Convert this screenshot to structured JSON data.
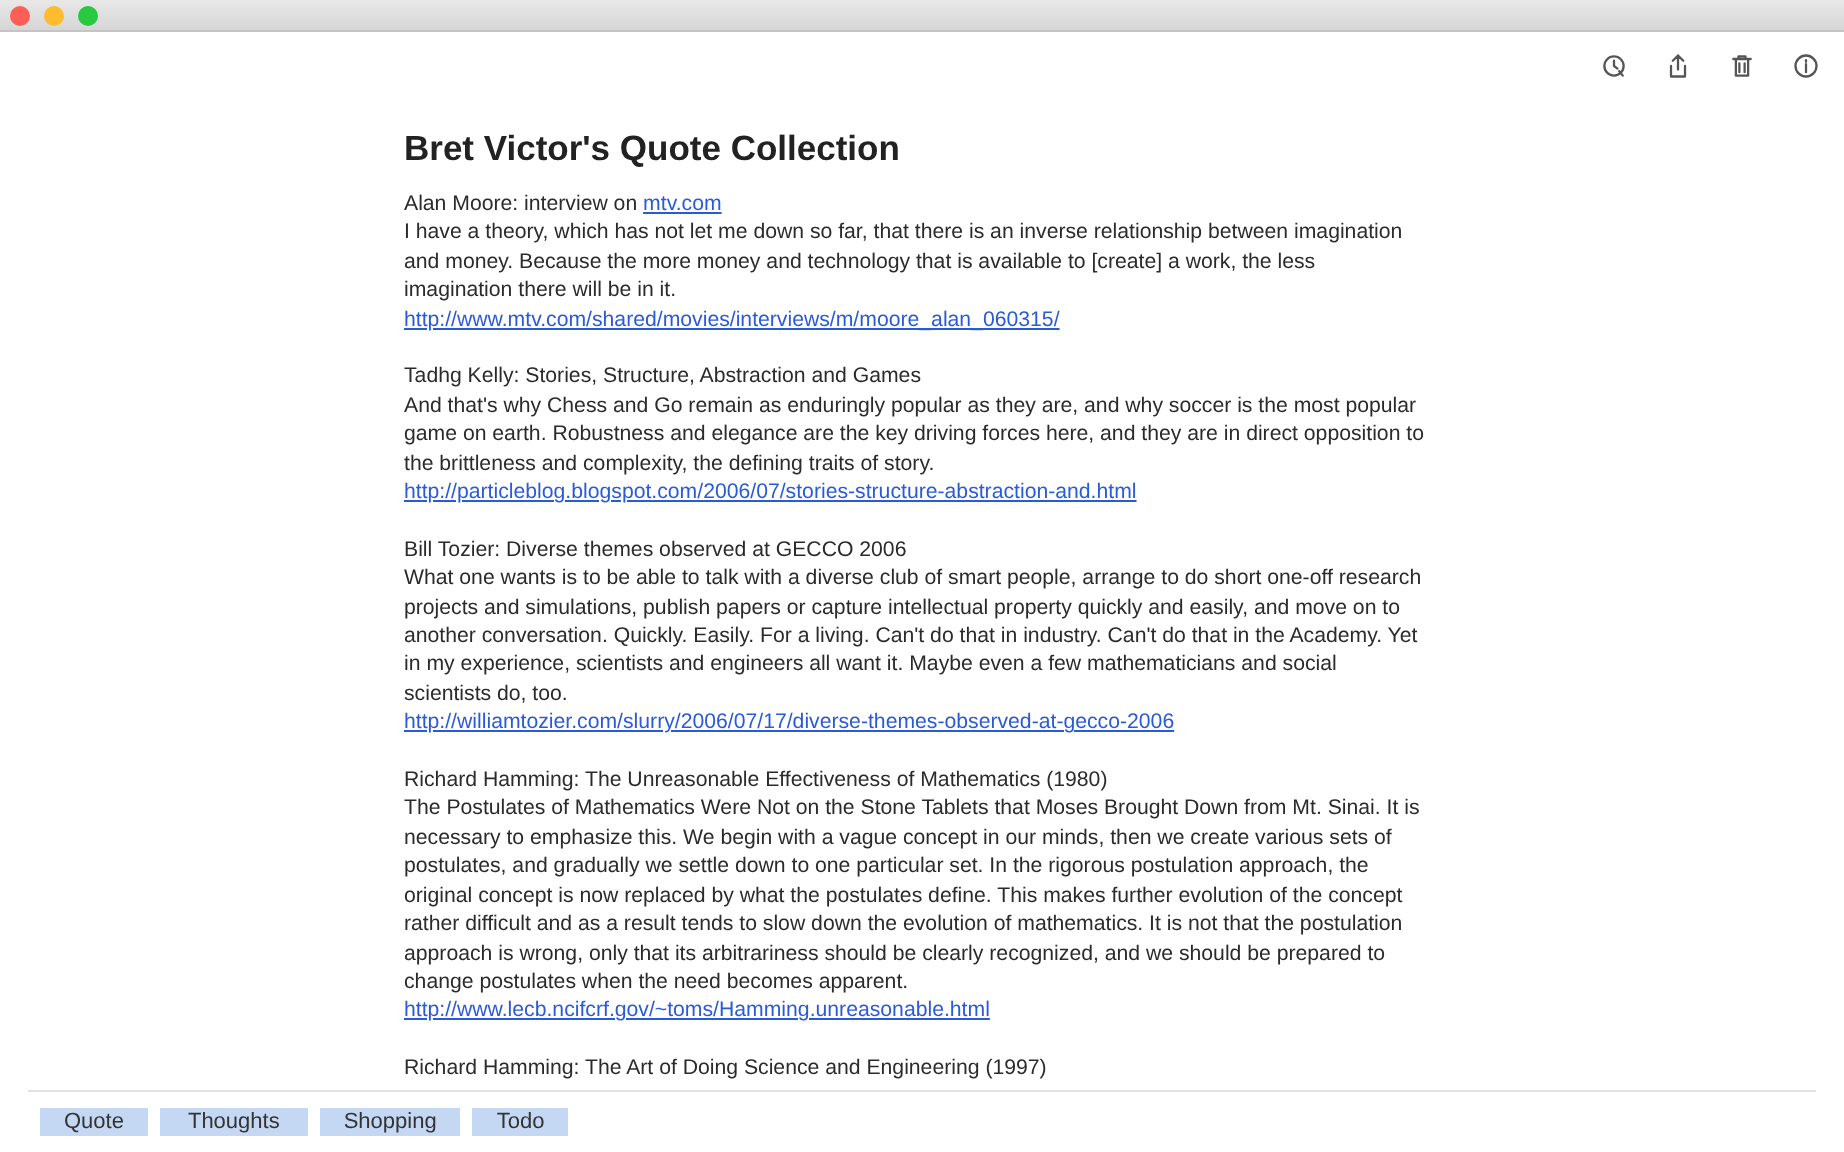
{
  "toolbar": {
    "buttons": [
      {
        "kind": "clock"
      },
      {
        "kind": "share"
      },
      {
        "kind": "trash"
      },
      {
        "kind": "info"
      }
    ]
  },
  "note": {
    "title": "Bret Victor's Quote Collection",
    "quotes": [
      {
        "source": "Alan Moore: interview on ",
        "source_link": "mtv.com",
        "body": "I have a theory, which has not let me down so far, that there is an inverse relationship between imagination and money. Because the more money and technology that is available to [create] a work, the less imagination there will be in it.",
        "url": "http://www.mtv.com/shared/movies/interviews/m/moore_alan_060315/"
      },
      {
        "source": "Tadhg Kelly: Stories, Structure, Abstraction and Games",
        "body": "And that's why Chess and Go remain as enduringly popular as they are, and why soccer is the most popular game on earth. Robustness and elegance are the key driving forces here, and they are in direct opposition to the brittleness and complexity, the defining traits of story.",
        "url": "http://particleblog.blogspot.com/2006/07/stories-structure-abstraction-and.html"
      },
      {
        "source": "Bill Tozier: Diverse themes observed at GECCO 2006",
        "body": "What one wants is to be able to talk with a diverse club of smart people, arrange to do short one-off research projects and simulations, publish papers or capture intellectual property quickly and easily, and move on to another conversation. Quickly. Easily. For a living. Can't do that in industry. Can't do that in the Academy. Yet in my experience, scientists and engineers all want it. Maybe even a few mathematicians and social scientists do, too.",
        "url": "http://williamtozier.com/slurry/2006/07/17/diverse-themes-observed-at-gecco-2006"
      },
      {
        "source": "Richard Hamming: The Unreasonable Effectiveness of Mathematics (1980)",
        "body": "The Postulates of Mathematics Were Not on the Stone Tablets that Moses Brought Down from Mt. Sinai. It is necessary to emphasize this. We begin with a vague concept in our minds, then we create various sets of postulates, and gradually we settle down to one particular set. In the rigorous postulation approach, the original concept is now replaced by what the postulates define. This makes further evolution of the concept rather difficult and as a result tends to slow down the evolution of mathematics. It is not that the postulation approach is wrong, only that its arbitrariness should be clearly recognized, and we should be prepared to change postulates when the need becomes apparent.",
        "url": "http://www.lecb.ncifcrf.gov/~toms/Hamming.unreasonable.html"
      },
      {
        "source": "Richard Hamming: The Art of Doing Science and Engineering (1997)"
      }
    ]
  },
  "tags": [
    "Quote",
    "Thoughts",
    "Shopping",
    "Todo"
  ]
}
